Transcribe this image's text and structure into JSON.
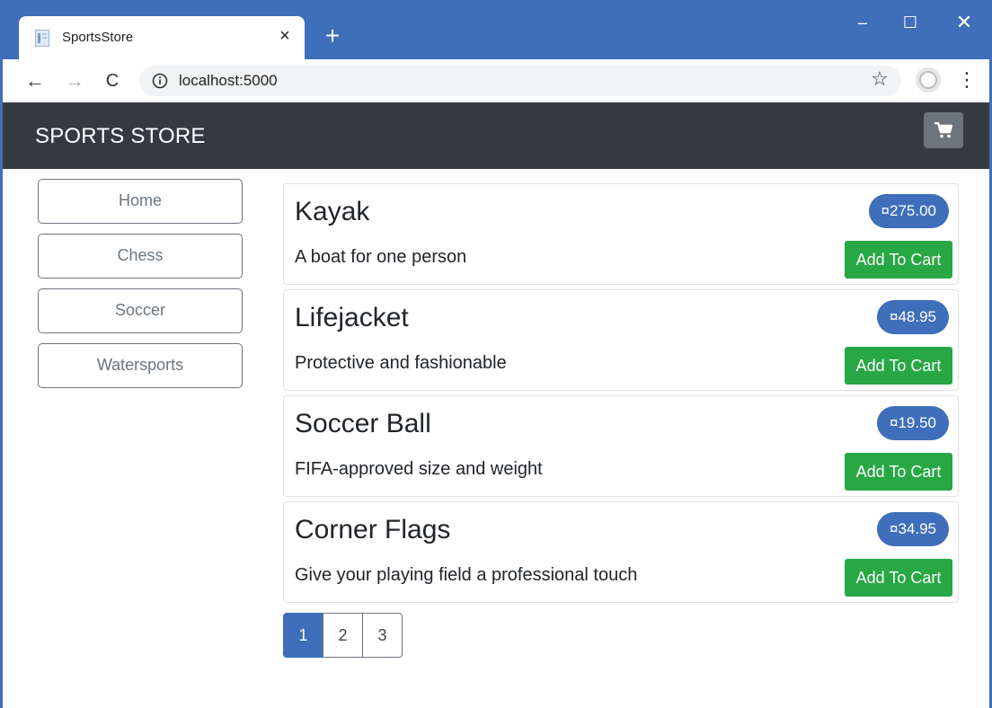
{
  "browser": {
    "tab_title": "SportsStore",
    "tab_close": "×",
    "new_tab": "+",
    "url": "localhost:5000",
    "window_controls": {
      "minimize": "–",
      "maximize": "☐",
      "close": "✕"
    },
    "nav": {
      "back": "←",
      "forward": "→",
      "reload": "C"
    },
    "star": "☆",
    "menu": "⋮"
  },
  "navbar": {
    "brand": "SPORTS STORE",
    "cart_icon": "cart-icon"
  },
  "categories": [
    {
      "label": "Home"
    },
    {
      "label": "Chess"
    },
    {
      "label": "Soccer"
    },
    {
      "label": "Watersports"
    }
  ],
  "products": [
    {
      "name": "Kayak",
      "price": "¤275.00",
      "description": "A boat for one person",
      "button": "Add To Cart"
    },
    {
      "name": "Lifejacket",
      "price": "¤48.95",
      "description": "Protective and fashionable",
      "button": "Add To Cart"
    },
    {
      "name": "Soccer Ball",
      "price": "¤19.50",
      "description": "FIFA-approved size and weight",
      "button": "Add To Cart"
    },
    {
      "name": "Corner Flags",
      "price": "¤34.95",
      "description": "Give your playing field a professional touch",
      "button": "Add To Cart"
    }
  ],
  "pagination": {
    "pages": [
      "1",
      "2",
      "3"
    ],
    "current": "1"
  },
  "colors": {
    "primary": "#3f6fba",
    "success": "#28a745",
    "navbar": "#343a40",
    "secondary": "#6c757d"
  }
}
